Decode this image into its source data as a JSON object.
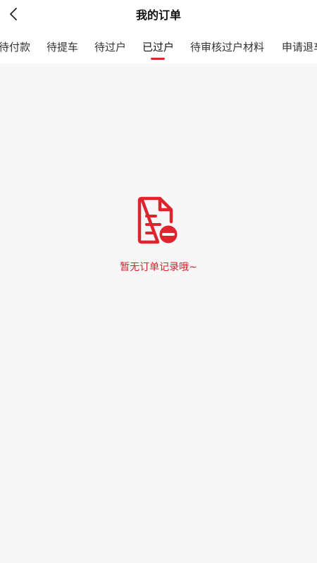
{
  "header": {
    "title": "我的订单",
    "back_icon": "chevron-left-icon"
  },
  "tabs": [
    {
      "label": "待付款",
      "active": false
    },
    {
      "label": "待提车",
      "active": false
    },
    {
      "label": "待过户",
      "active": false
    },
    {
      "label": "已过户",
      "active": true
    },
    {
      "label": "待审核过户材料",
      "active": false
    },
    {
      "label": "申请退车",
      "active": false
    }
  ],
  "empty_state": {
    "icon": "document-remove-icon",
    "message": "暂无订单记录哦~"
  },
  "colors": {
    "accent": "#e0242e",
    "background": "#f7f7f7"
  }
}
